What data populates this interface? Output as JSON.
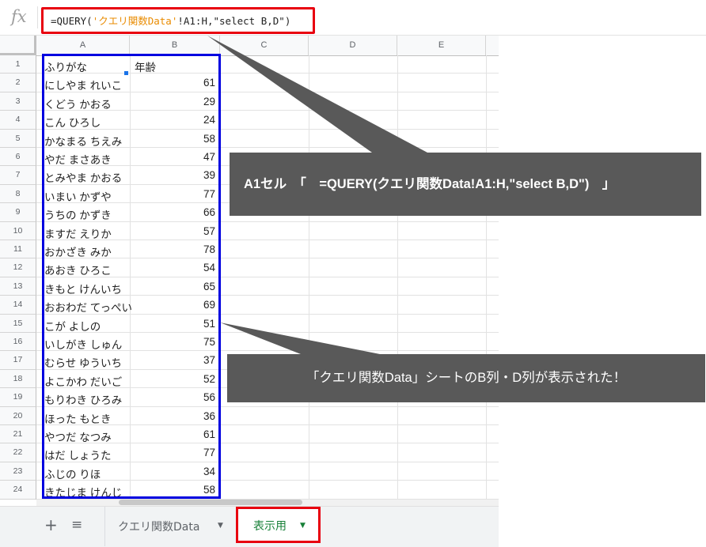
{
  "formula_bar": {
    "fx_label": "fx",
    "formula_parts": [
      "=QUERY(",
      "'クエリ関数Data'",
      "!A1:H,",
      "\"select B,D\"",
      ")"
    ]
  },
  "columns": [
    "A",
    "B",
    "C",
    "D",
    "E"
  ],
  "rows": [
    {
      "n": "1",
      "a": "ふりがな",
      "b": "年齢"
    },
    {
      "n": "2",
      "a": "にしやま れいこ",
      "b": "61"
    },
    {
      "n": "3",
      "a": "くどう かおる",
      "b": "29"
    },
    {
      "n": "4",
      "a": "こん ひろし",
      "b": "24"
    },
    {
      "n": "5",
      "a": "かなまる ちえみ",
      "b": "58"
    },
    {
      "n": "6",
      "a": "やだ まさあき",
      "b": "47"
    },
    {
      "n": "7",
      "a": "とみやま かおる",
      "b": "39"
    },
    {
      "n": "8",
      "a": "いまい かずや",
      "b": "77"
    },
    {
      "n": "9",
      "a": "うちの かずき",
      "b": "66"
    },
    {
      "n": "10",
      "a": "ますだ えりか",
      "b": "57"
    },
    {
      "n": "11",
      "a": "おかざき みか",
      "b": "78"
    },
    {
      "n": "12",
      "a": "あおき ひろこ",
      "b": "54"
    },
    {
      "n": "13",
      "a": "きもと けんいち",
      "b": "65"
    },
    {
      "n": "14",
      "a": "おおわだ てっぺい",
      "b": "69"
    },
    {
      "n": "15",
      "a": "こが よしの",
      "b": "51"
    },
    {
      "n": "16",
      "a": "いしがき しゅん",
      "b": "75"
    },
    {
      "n": "17",
      "a": "むらせ ゆういち",
      "b": "37"
    },
    {
      "n": "18",
      "a": "よこかわ だいご",
      "b": "52"
    },
    {
      "n": "19",
      "a": "もりわき ひろみ",
      "b": "56"
    },
    {
      "n": "20",
      "a": "ほった もとき",
      "b": "36"
    },
    {
      "n": "21",
      "a": "やつだ なつみ",
      "b": "61"
    },
    {
      "n": "22",
      "a": "はだ しょうた",
      "b": "77"
    },
    {
      "n": "23",
      "a": "ふじの りほ",
      "b": "34"
    },
    {
      "n": "24",
      "a": "きたじま けんじ",
      "b": "58"
    }
  ],
  "callouts": {
    "formula_note": "A1セル　「　=QUERY(クエリ関数Data!A1:H,\"select B,D\")　」",
    "result_note": "「クエリ関数Data」シートのB列・D列が表示された！"
  },
  "sheet_tabs": {
    "add_icon": "+",
    "list_icon": "≡",
    "tab1_label": "クエリ関数Data",
    "tab2_label": "表示用",
    "dropdown_icon": "▼"
  },
  "colors": {
    "highlight_red": "#e8000f",
    "highlight_blue": "#0000e0",
    "callout_bg": "#595959",
    "active_tab_green": "#188038",
    "formula_string_orange": "#e98b00"
  }
}
